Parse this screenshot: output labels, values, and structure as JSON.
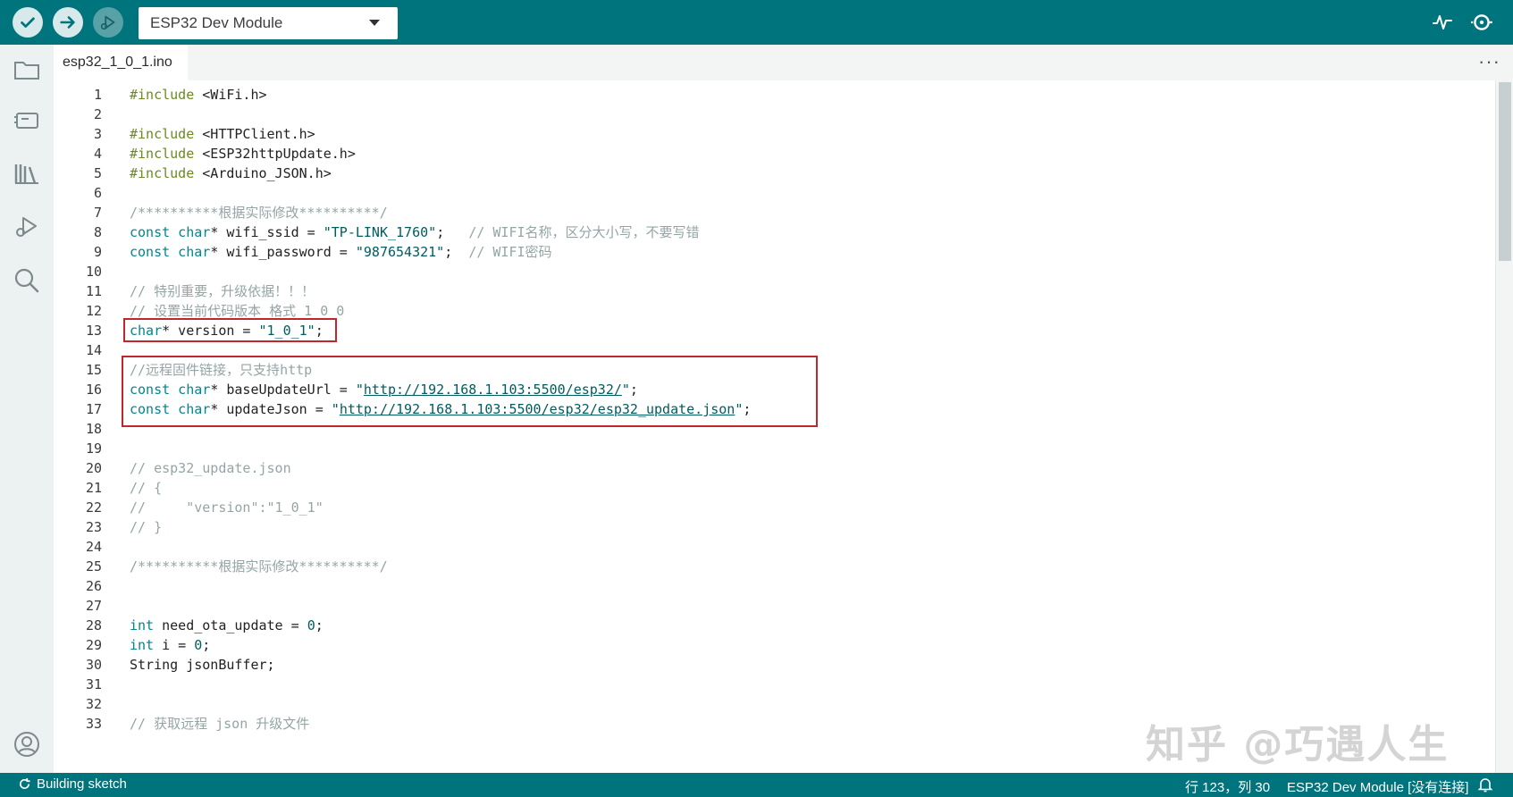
{
  "toolbar": {
    "board_name": "ESP32 Dev Module"
  },
  "tab": {
    "filename": "esp32_1_0_1.ino",
    "more": "···"
  },
  "code_lines": [
    {
      "n": "1",
      "parts": [
        {
          "c": "kw-pp",
          "t": "#include"
        },
        {
          "c": "",
          "t": " <WiFi.h>"
        }
      ]
    },
    {
      "n": "2",
      "parts": []
    },
    {
      "n": "3",
      "parts": [
        {
          "c": "kw-pp",
          "t": "#include"
        },
        {
          "c": "",
          "t": " <HTTPClient.h>"
        }
      ]
    },
    {
      "n": "4",
      "parts": [
        {
          "c": "kw-pp",
          "t": "#include"
        },
        {
          "c": "",
          "t": " <ESP32httpUpdate.h>"
        }
      ]
    },
    {
      "n": "5",
      "parts": [
        {
          "c": "kw-pp",
          "t": "#include"
        },
        {
          "c": "",
          "t": " <Arduino_JSON.h>"
        }
      ]
    },
    {
      "n": "6",
      "parts": []
    },
    {
      "n": "7",
      "parts": [
        {
          "c": "cm",
          "t": "/**********根据实际修改**********/"
        }
      ]
    },
    {
      "n": "8",
      "parts": [
        {
          "c": "kw-type",
          "t": "const char"
        },
        {
          "c": "",
          "t": "* wifi_ssid = "
        },
        {
          "c": "str",
          "t": "\"TP-LINK_1760\""
        },
        {
          "c": "",
          "t": ";   "
        },
        {
          "c": "cm",
          "t": "// WIFI名称，区分大小写，不要写错"
        }
      ]
    },
    {
      "n": "9",
      "parts": [
        {
          "c": "kw-type",
          "t": "const char"
        },
        {
          "c": "",
          "t": "* wifi_password = "
        },
        {
          "c": "str",
          "t": "\"987654321\""
        },
        {
          "c": "",
          "t": ";  "
        },
        {
          "c": "cm",
          "t": "// WIFI密码"
        }
      ]
    },
    {
      "n": "10",
      "parts": []
    },
    {
      "n": "11",
      "parts": [
        {
          "c": "cm",
          "t": "// 特别重要，升级依据！！！"
        }
      ]
    },
    {
      "n": "12",
      "parts": [
        {
          "c": "cm",
          "t": "// 设置当前代码版本 格式 1_0_0"
        }
      ]
    },
    {
      "n": "13",
      "parts": [
        {
          "c": "kw-type",
          "t": "char"
        },
        {
          "c": "",
          "t": "* version = "
        },
        {
          "c": "str",
          "t": "\"1_0_1\""
        },
        {
          "c": "",
          "t": ";"
        }
      ]
    },
    {
      "n": "14",
      "parts": []
    },
    {
      "n": "15",
      "parts": [
        {
          "c": "cm",
          "t": "//远程固件链接，只支持http"
        }
      ]
    },
    {
      "n": "16",
      "parts": [
        {
          "c": "kw-type",
          "t": "const char"
        },
        {
          "c": "",
          "t": "* baseUpdateUrl = "
        },
        {
          "c": "str",
          "t": "\""
        },
        {
          "c": "link",
          "t": "http://192.168.1.103:5500/esp32/"
        },
        {
          "c": "str",
          "t": "\""
        },
        {
          "c": "",
          "t": ";"
        }
      ]
    },
    {
      "n": "17",
      "parts": [
        {
          "c": "kw-type",
          "t": "const char"
        },
        {
          "c": "",
          "t": "* updateJson = "
        },
        {
          "c": "str",
          "t": "\""
        },
        {
          "c": "link",
          "t": "http://192.168.1.103:5500/esp32/esp32_update.json"
        },
        {
          "c": "str",
          "t": "\""
        },
        {
          "c": "",
          "t": ";"
        }
      ]
    },
    {
      "n": "18",
      "parts": []
    },
    {
      "n": "19",
      "parts": []
    },
    {
      "n": "20",
      "parts": [
        {
          "c": "cm",
          "t": "// esp32_update.json"
        }
      ]
    },
    {
      "n": "21",
      "parts": [
        {
          "c": "cm",
          "t": "// {"
        }
      ]
    },
    {
      "n": "22",
      "parts": [
        {
          "c": "cm",
          "t": "//     \"version\":\"1_0_1\""
        }
      ]
    },
    {
      "n": "23",
      "parts": [
        {
          "c": "cm",
          "t": "// }"
        }
      ]
    },
    {
      "n": "24",
      "parts": []
    },
    {
      "n": "25",
      "parts": [
        {
          "c": "cm",
          "t": "/**********根据实际修改**********/"
        }
      ]
    },
    {
      "n": "26",
      "parts": []
    },
    {
      "n": "27",
      "parts": []
    },
    {
      "n": "28",
      "parts": [
        {
          "c": "kw-type",
          "t": "int"
        },
        {
          "c": "",
          "t": " need_ota_update = "
        },
        {
          "c": "str",
          "t": "0"
        },
        {
          "c": "",
          "t": ";"
        }
      ]
    },
    {
      "n": "29",
      "parts": [
        {
          "c": "kw-type",
          "t": "int"
        },
        {
          "c": "",
          "t": " i = "
        },
        {
          "c": "str",
          "t": "0"
        },
        {
          "c": "",
          "t": ";"
        }
      ]
    },
    {
      "n": "30",
      "parts": [
        {
          "c": "",
          "t": "String jsonBuffer;"
        }
      ]
    },
    {
      "n": "31",
      "parts": []
    },
    {
      "n": "32",
      "parts": []
    },
    {
      "n": "33",
      "parts": [
        {
          "c": "cm",
          "t": "// 获取远程 json 升级文件"
        }
      ]
    }
  ],
  "watermark": "知乎 @巧遇人生",
  "status": {
    "build": "Building sketch",
    "position": "行 123，列 30",
    "board": "ESP32 Dev Module [没有连接]"
  },
  "icons": {
    "verify": "checkmark-icon",
    "upload": "arrow-right-icon",
    "debug": "debug-play-icon",
    "plotter": "serial-plotter-icon",
    "monitor": "serial-monitor-icon"
  }
}
